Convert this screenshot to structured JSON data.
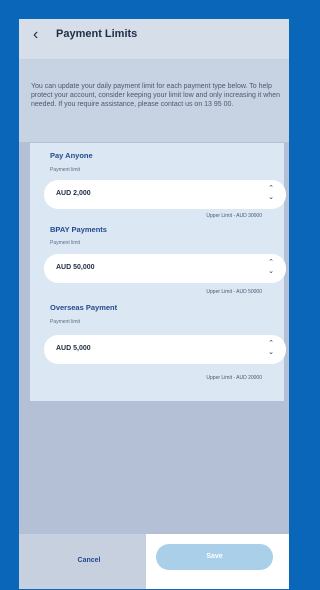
{
  "header": {
    "title": "Payment Limits",
    "back_label": "‹"
  },
  "info": {
    "text": "You can update your daily payment limit for each payment type below. To help protect your account, consider keeping your limit low and only increasing it when needed. If you require assistance, please contact us on 13 95 00."
  },
  "limits": [
    {
      "title": "Pay Anyone",
      "sub": "Payment limit",
      "value": "AUD 2,000",
      "upper": "Upper Limit - AUD 30000"
    },
    {
      "title": "BPAY Payments",
      "sub": "Payment limit",
      "value": "AUD 50,000",
      "upper": "Upper Limit - AUD 50000"
    },
    {
      "title": "Overseas Payment",
      "sub": "Payment limit",
      "value": "AUD 5,000",
      "upper": "Upper Limit - AUD 20000"
    }
  ],
  "footer": {
    "cancel_label": "Cancel",
    "save_label": "Save"
  },
  "colors": {
    "frame": "#0a66b8",
    "accent_text": "#244b8e",
    "save_button": "#a9cfe9"
  },
  "icons": {
    "back": "chevron-left-icon",
    "stepper": "stepper-icon"
  }
}
